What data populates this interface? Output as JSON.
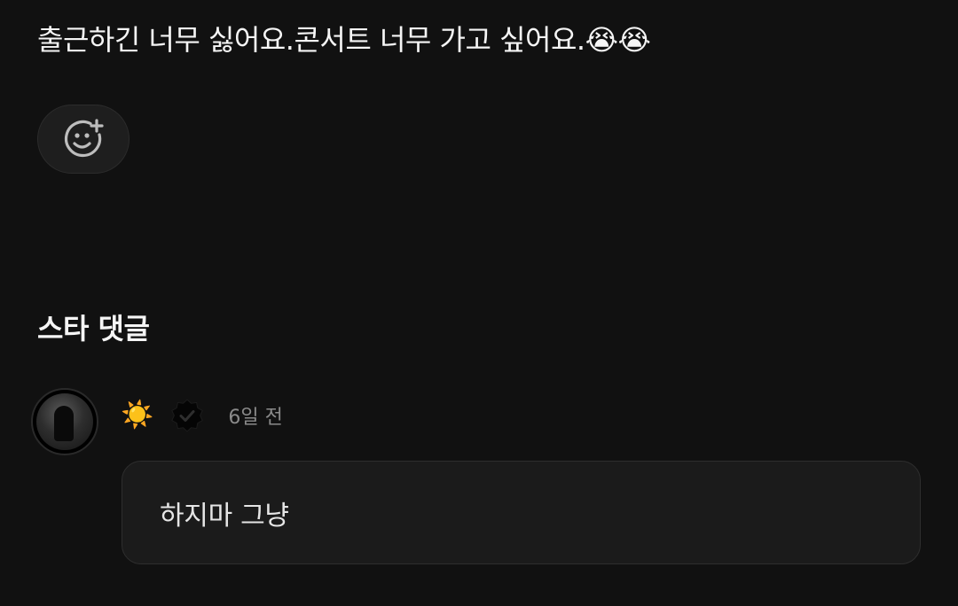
{
  "post": {
    "text": "출근하긴 너무 싫어요.콘서트 너무 가고 싶어요.😭😭"
  },
  "reaction": {
    "icon": "emoji-add-icon"
  },
  "star_comments": {
    "title": "스타 댓글",
    "items": [
      {
        "avatar": "profile-photo",
        "nickname_emoji": "☀️",
        "badge_icon": "verified-badge-icon",
        "time": "6일 전",
        "text": "하지마 그냥"
      }
    ]
  },
  "colors": {
    "background": "#111111",
    "bubble": "#1b1b1b",
    "muted_text": "#8a8a8a"
  }
}
